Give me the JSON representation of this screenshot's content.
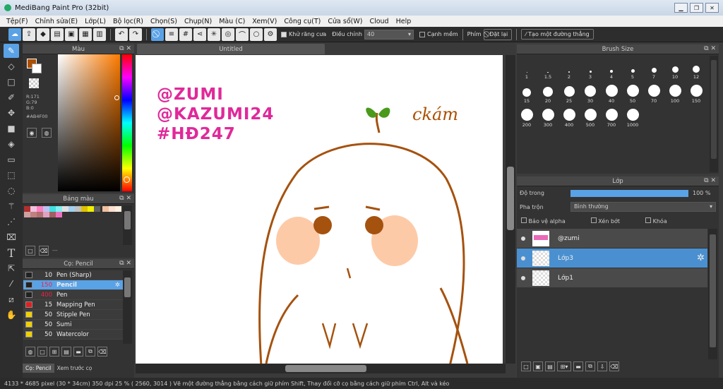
{
  "window": {
    "title": "MediBang Paint Pro (32bit)"
  },
  "menu": [
    "Tệp(F)",
    "Chỉnh sửa(E)",
    "Lớp(L)",
    "Bộ lọc(R)",
    "Chọn(S)",
    "Chụp(N)",
    "Màu (C)",
    "Xem(V)",
    "Công cụ(T)",
    "Cửa sổ(W)",
    "Cloud",
    "Help"
  ],
  "toolbar": {
    "antialias_label": "Khử răng cưa",
    "adjust_label": "Điều chỉnh",
    "adjust_value": "40",
    "smooth_label": "Cạnh mềm",
    "key_label": "Phím",
    "reset_label": "Đặt lại",
    "line_label": "Tạo một đường thẳng"
  },
  "color_panel": {
    "title": "Màu",
    "r": "R:171",
    "g": "G:79",
    "b": "B:0",
    "hex": "#AB4F00",
    "foreground": "#AB4F00"
  },
  "palette_panel": {
    "title": "Bảng màu",
    "footer": "---"
  },
  "brush_panel": {
    "title": "Cọ: Pencil",
    "brushes": [
      {
        "size": "10",
        "name": "Pen (Sharp)",
        "color": "#222222"
      },
      {
        "size": "150",
        "name": "Pencil",
        "color": "#222222"
      },
      {
        "size": "400",
        "name": "Pen",
        "color": "#222222"
      },
      {
        "size": "15",
        "name": "Mapping Pen",
        "color": "#e02020"
      },
      {
        "size": "50",
        "name": "Stipple Pen",
        "color": "#f0d000"
      },
      {
        "size": "50",
        "name": "Sumi",
        "color": "#f0d000"
      },
      {
        "size": "50",
        "name": "Watercolor",
        "color": "#f0d000"
      }
    ],
    "tabs": [
      "Cọ: Pencil",
      "Xem trước cọ"
    ]
  },
  "canvas": {
    "tab_title": "Untitled",
    "handwriting": [
      "@ZUMI",
      "@KAZUMI24",
      "#HĐ247"
    ],
    "caption": "ckám"
  },
  "brush_size_panel": {
    "title": "Brush Size",
    "sizes": [
      "1",
      "1.5",
      "2",
      "3",
      "4",
      "5",
      "7",
      "10",
      "12",
      "15",
      "20",
      "25",
      "30",
      "40",
      "50",
      "70",
      "100",
      "150",
      "200",
      "300",
      "400",
      "500",
      "700",
      "1000"
    ]
  },
  "layer_panel": {
    "title": "Lớp",
    "opacity_label": "Độ trong",
    "opacity_value": "100 %",
    "opacity": 1.0,
    "blend_label": "Pha trộn",
    "blend_value": "Bình thường",
    "protect_alpha": "Bảo vệ alpha",
    "clip": "Xén bớt",
    "lock": "Khóa",
    "layers": [
      {
        "name": "@zumi",
        "selected": false
      },
      {
        "name": "Lớp3",
        "selected": true
      },
      {
        "name": "Lớp1",
        "selected": false
      }
    ]
  },
  "status": {
    "text": "4133 * 4685 pixel   (30 * 34cm)   350 dpi   25 %   ( 2560, 3014 )   Vẽ một đường thẳng bằng cách giữ phím Shift, Thay đổi cỡ cọ bằng cách giữ phím Ctrl, Alt và kéo"
  }
}
